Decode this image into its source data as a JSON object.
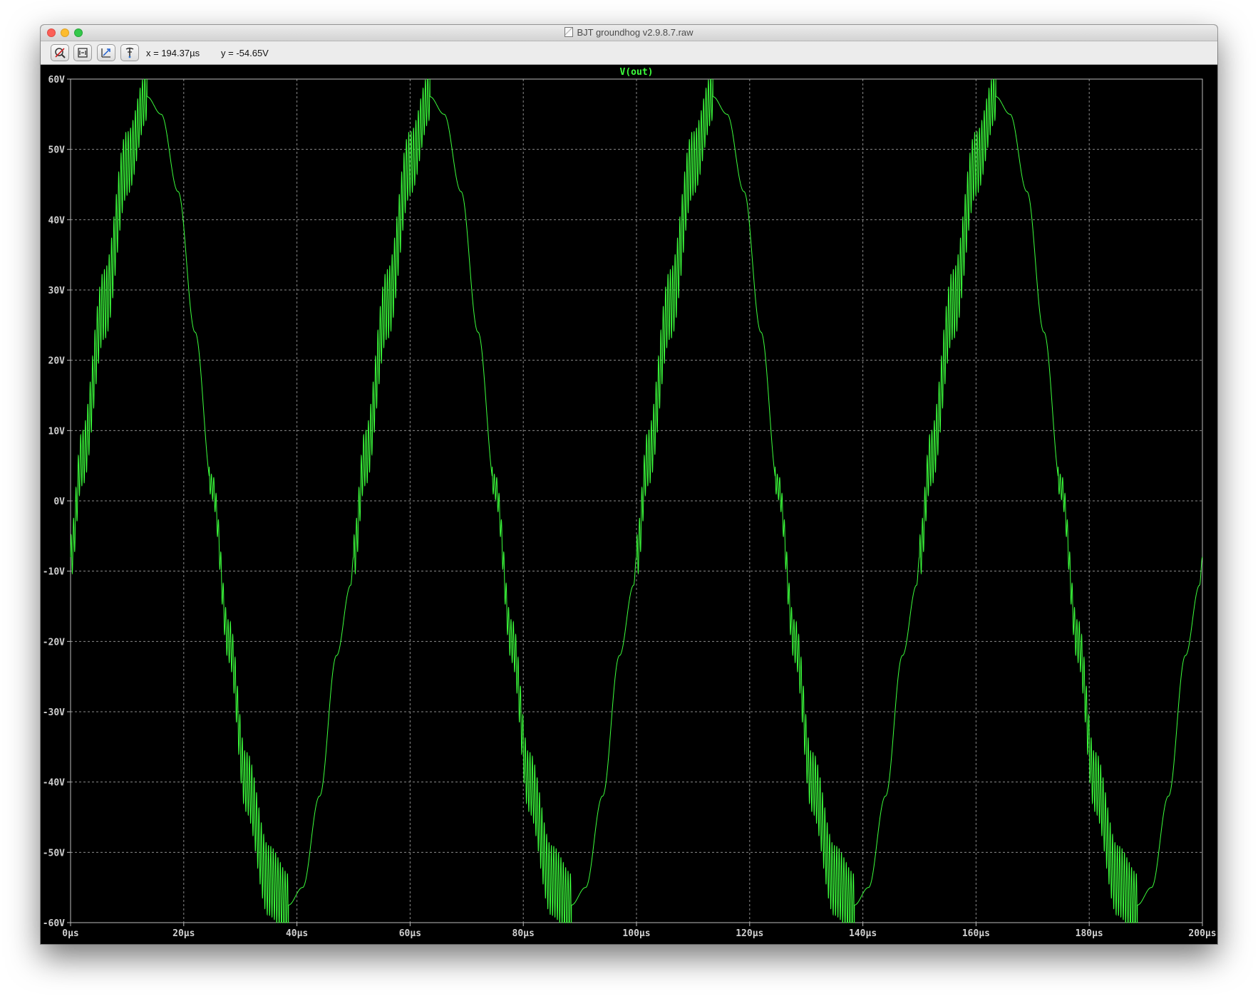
{
  "window": {
    "title": "BJT groundhog v2.9.8.7.raw"
  },
  "toolbar": {
    "buttons": [
      {
        "name": "autorange-button",
        "icon": "magnifier-cross-icon"
      },
      {
        "name": "zoom-fit-button",
        "icon": "zoom-extents-icon"
      },
      {
        "name": "zoom-area-button",
        "icon": "zoom-area-icon"
      },
      {
        "name": "probe-button",
        "icon": "probe-icon"
      }
    ],
    "cursor_x": "x = 194.37µs",
    "cursor_y": "y = -54.65V"
  },
  "colors": {
    "trace": "#3cff3c",
    "trace_title": "#3cff3c",
    "grid": "#8a8a8a",
    "background": "#000000"
  },
  "chart_data": {
    "type": "line",
    "title": "V(out)",
    "xlabel": "",
    "ylabel": "",
    "xlim": [
      0,
      200
    ],
    "ylim": [
      -60,
      60
    ],
    "x_unit": "µs",
    "y_unit": "V",
    "grid": true,
    "x_ticks": [
      "0µs",
      "20µs",
      "40µs",
      "60µs",
      "80µs",
      "100µs",
      "120µs",
      "140µs",
      "160µs",
      "180µs",
      "200µs"
    ],
    "y_ticks": [
      "60V",
      "50V",
      "40V",
      "30V",
      "20V",
      "10V",
      "0V",
      "-10V",
      "-20V",
      "-30V",
      "-40V",
      "-50V",
      "-60V"
    ],
    "series": [
      {
        "name": "V(out)",
        "period_us": 50,
        "envelope_x": [
          0,
          2,
          6,
          10,
          13.5,
          16,
          19,
          22,
          25,
          28,
          31,
          35,
          38.5,
          41,
          44,
          47,
          49.5,
          50
        ],
        "envelope_y": [
          -8,
          6,
          28,
          48,
          57.5,
          55,
          44,
          24,
          2,
          -20,
          -40,
          -54,
          -57.5,
          -55,
          -42,
          -22,
          -12,
          -8
        ],
        "ripple_ranges_us": [
          [
            0,
            13.5
          ],
          [
            24.5,
            38.5
          ]
        ],
        "ripple_amplitude_v": 5
      }
    ]
  }
}
